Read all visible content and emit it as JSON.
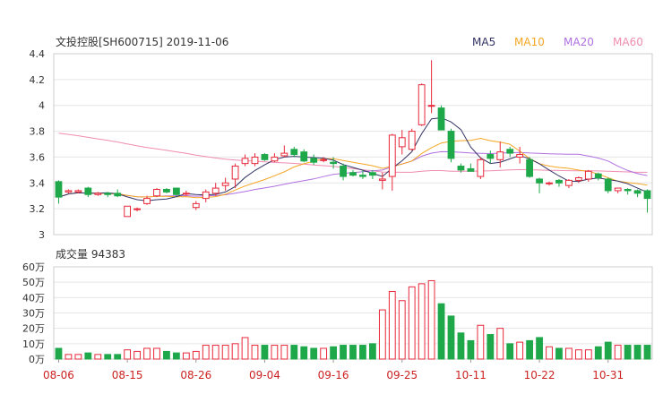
{
  "header": {
    "title": "文投控股[SH600715] 2019-11-06",
    "volume_label": "成交量 94383"
  },
  "legend": [
    {
      "name": "MA5",
      "color": "#333366"
    },
    {
      "name": "MA10",
      "color": "#f5a623"
    },
    {
      "name": "MA20",
      "color": "#b070e0"
    },
    {
      "name": "MA60",
      "color": "#f08cb0"
    }
  ],
  "colors": {
    "up": "#e8283a",
    "down": "#1ea84a",
    "grid": "#e6e6e6"
  },
  "chart_data": {
    "type": "candlestick",
    "price_axis": {
      "ylim": [
        3.0,
        4.4
      ],
      "ticks": [
        "4.4",
        "4.2",
        "4",
        "3.8",
        "3.6",
        "3.4",
        "3.2",
        "3"
      ]
    },
    "volume_axis": {
      "ylim": [
        0,
        60
      ],
      "ticks": [
        "60万",
        "50万",
        "40万",
        "30万",
        "20万",
        "10万",
        "0万"
      ]
    },
    "x_labels": [
      {
        "label": "08-06",
        "index": 0
      },
      {
        "label": "08-15",
        "index": 7
      },
      {
        "label": "08-26",
        "index": 14
      },
      {
        "label": "09-04",
        "index": 21
      },
      {
        "label": "09-16",
        "index": 28
      },
      {
        "label": "09-25",
        "index": 35
      },
      {
        "label": "10-11",
        "index": 42
      },
      {
        "label": "10-22",
        "index": 49
      },
      {
        "label": "10-31",
        "index": 56
      }
    ],
    "ohlc": [
      [
        3.41,
        3.42,
        3.24,
        3.29
      ],
      [
        3.33,
        3.35,
        3.32,
        3.34
      ],
      [
        3.33,
        3.35,
        3.32,
        3.34
      ],
      [
        3.36,
        3.37,
        3.29,
        3.31
      ],
      [
        3.31,
        3.33,
        3.3,
        3.32
      ],
      [
        3.32,
        3.33,
        3.29,
        3.31
      ],
      [
        3.32,
        3.35,
        3.29,
        3.3
      ],
      [
        3.14,
        3.22,
        3.14,
        3.22
      ],
      [
        3.2,
        3.21,
        3.18,
        3.2
      ],
      [
        3.24,
        3.3,
        3.23,
        3.28
      ],
      [
        3.3,
        3.36,
        3.29,
        3.35
      ],
      [
        3.35,
        3.36,
        3.32,
        3.33
      ],
      [
        3.36,
        3.36,
        3.3,
        3.31
      ],
      [
        3.32,
        3.34,
        3.3,
        3.32
      ],
      [
        3.21,
        3.26,
        3.19,
        3.24
      ],
      [
        3.28,
        3.35,
        3.25,
        3.33
      ],
      [
        3.32,
        3.4,
        3.3,
        3.36
      ],
      [
        3.38,
        3.44,
        3.34,
        3.4
      ],
      [
        3.43,
        3.55,
        3.36,
        3.53
      ],
      [
        3.55,
        3.62,
        3.53,
        3.59
      ],
      [
        3.55,
        3.63,
        3.53,
        3.6
      ],
      [
        3.62,
        3.63,
        3.57,
        3.58
      ],
      [
        3.57,
        3.63,
        3.56,
        3.6
      ],
      [
        3.61,
        3.69,
        3.6,
        3.63
      ],
      [
        3.66,
        3.68,
        3.6,
        3.62
      ],
      [
        3.64,
        3.66,
        3.56,
        3.57
      ],
      [
        3.59,
        3.62,
        3.54,
        3.56
      ],
      [
        3.58,
        3.6,
        3.56,
        3.58
      ],
      [
        3.56,
        3.6,
        3.51,
        3.55
      ],
      [
        3.53,
        3.55,
        3.42,
        3.45
      ],
      [
        3.48,
        3.5,
        3.45,
        3.46
      ],
      [
        3.46,
        3.5,
        3.43,
        3.45
      ],
      [
        3.48,
        3.5,
        3.43,
        3.46
      ],
      [
        3.42,
        3.48,
        3.35,
        3.43
      ],
      [
        3.45,
        3.78,
        3.34,
        3.77
      ],
      [
        3.68,
        3.81,
        3.62,
        3.75
      ],
      [
        3.66,
        3.82,
        3.65,
        3.8
      ],
      [
        3.85,
        4.17,
        3.84,
        4.16
      ],
      [
        4.0,
        4.35,
        3.94,
        4.0
      ],
      [
        3.98,
        4.0,
        3.82,
        3.81
      ],
      [
        3.8,
        3.82,
        3.56,
        3.59
      ],
      [
        3.53,
        3.55,
        3.48,
        3.5
      ],
      [
        3.51,
        3.55,
        3.5,
        3.49
      ],
      [
        3.45,
        3.6,
        3.43,
        3.58
      ],
      [
        3.62,
        3.65,
        3.55,
        3.59
      ],
      [
        3.58,
        3.72,
        3.52,
        3.64
      ],
      [
        3.66,
        3.68,
        3.6,
        3.63
      ],
      [
        3.6,
        3.68,
        3.55,
        3.62
      ],
      [
        3.58,
        3.6,
        3.44,
        3.45
      ],
      [
        3.43,
        3.44,
        3.32,
        3.4
      ],
      [
        3.4,
        3.41,
        3.38,
        3.4
      ],
      [
        3.42,
        3.43,
        3.37,
        3.4
      ],
      [
        3.38,
        3.43,
        3.36,
        3.42
      ],
      [
        3.42,
        3.45,
        3.4,
        3.44
      ],
      [
        3.43,
        3.5,
        3.41,
        3.49
      ],
      [
        3.47,
        3.48,
        3.42,
        3.44
      ],
      [
        3.43,
        3.44,
        3.32,
        3.34
      ],
      [
        3.34,
        3.36,
        3.32,
        3.36
      ],
      [
        3.35,
        3.36,
        3.31,
        3.34
      ],
      [
        3.34,
        3.35,
        3.29,
        3.32
      ],
      [
        3.34,
        3.35,
        3.17,
        3.28
      ]
    ],
    "volume": [
      7,
      3,
      3,
      4,
      3,
      3,
      3,
      6,
      5,
      7,
      7,
      5,
      4,
      4,
      5,
      9,
      9,
      9,
      10,
      14,
      9,
      9,
      9,
      9,
      9,
      8,
      7,
      7,
      8,
      9,
      9,
      9,
      10,
      32,
      44,
      38,
      47,
      49,
      51,
      36,
      28,
      17,
      12,
      22,
      16,
      20,
      10,
      11,
      12,
      14,
      8,
      7,
      7,
      6,
      6,
      8,
      11,
      9,
      9,
      9,
      9
    ]
  }
}
